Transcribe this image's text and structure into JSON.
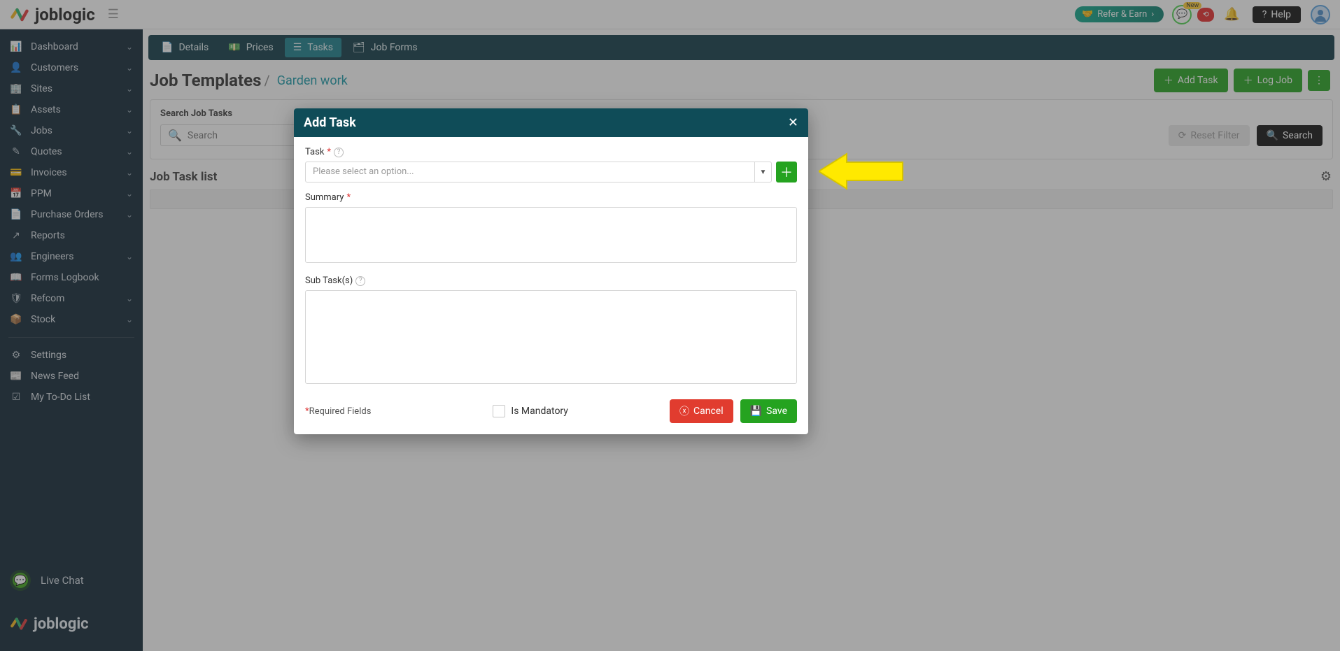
{
  "header": {
    "brand": "joblogic",
    "refer_label": "Refer & Earn",
    "new_badge": "New",
    "help_label": "Help"
  },
  "sidebar": {
    "items": [
      {
        "icon": "speed",
        "label": "Dashboard",
        "expandable": true
      },
      {
        "icon": "user",
        "label": "Customers",
        "expandable": true
      },
      {
        "icon": "building",
        "label": "Sites",
        "expandable": true
      },
      {
        "icon": "clipboard",
        "label": "Assets",
        "expandable": true
      },
      {
        "icon": "wrench",
        "label": "Jobs",
        "expandable": true
      },
      {
        "icon": "edit",
        "label": "Quotes",
        "expandable": true
      },
      {
        "icon": "wallet",
        "label": "Invoices",
        "expandable": true
      },
      {
        "icon": "calendar",
        "label": "PPM",
        "expandable": true
      },
      {
        "icon": "doc",
        "label": "Purchase Orders",
        "expandable": true
      },
      {
        "icon": "export",
        "label": "Reports",
        "expandable": false
      },
      {
        "icon": "users",
        "label": "Engineers",
        "expandable": true
      },
      {
        "icon": "book",
        "label": "Forms Logbook",
        "expandable": false
      },
      {
        "icon": "shield",
        "label": "Refcom",
        "expandable": true
      },
      {
        "icon": "box",
        "label": "Stock",
        "expandable": true
      }
    ],
    "bottom": [
      {
        "icon": "gear",
        "label": "Settings"
      },
      {
        "icon": "news",
        "label": "News Feed"
      },
      {
        "icon": "todo",
        "label": "My To-Do List"
      }
    ],
    "live_chat": "Live Chat",
    "footer_brand": "joblogic"
  },
  "tabs": [
    {
      "icon": "doc",
      "label": "Details",
      "active": false
    },
    {
      "icon": "money",
      "label": "Prices",
      "active": false
    },
    {
      "icon": "list",
      "label": "Tasks",
      "active": true
    },
    {
      "icon": "form",
      "label": "Job Forms",
      "active": false
    }
  ],
  "page": {
    "title": "Job Templates",
    "crumb": "Garden work",
    "add_task_btn": "Add Task",
    "log_job_btn": "Log Job",
    "search_label": "Search Job Tasks",
    "search_placeholder": "Search",
    "reset_btn": "Reset Filter",
    "search_btn": "Search",
    "list_title": "Job Task list"
  },
  "modal": {
    "title": "Add Task",
    "task_label": "Task",
    "task_placeholder": "Please select an option...",
    "summary_label": "Summary",
    "subtasks_label": "Sub Task(s)",
    "required_note": "Required Fields",
    "mandatory_label": "Is Mandatory",
    "cancel": "Cancel",
    "save": "Save"
  }
}
